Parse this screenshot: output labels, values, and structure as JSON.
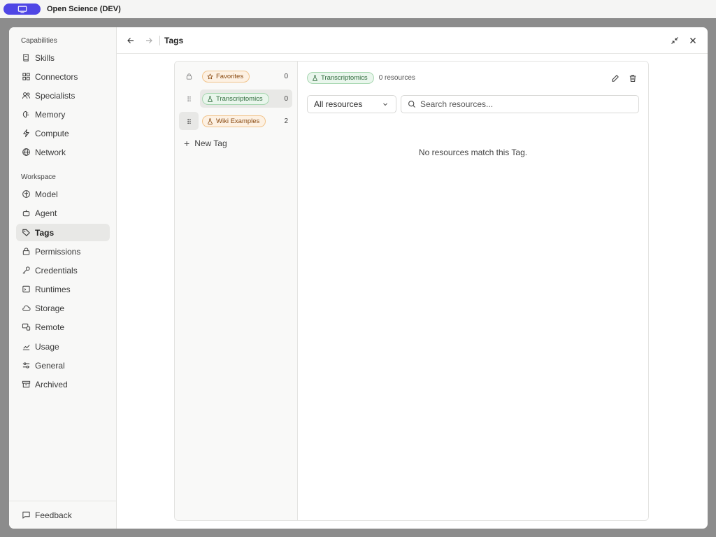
{
  "app": {
    "title": "Open Science (DEV)"
  },
  "sidebar": {
    "capabilities_label": "Capabilities",
    "capabilities": [
      {
        "label": "Skills",
        "icon": "book-icon"
      },
      {
        "label": "Connectors",
        "icon": "grid-icon"
      },
      {
        "label": "Specialists",
        "icon": "users-icon"
      },
      {
        "label": "Memory",
        "icon": "brain-icon"
      },
      {
        "label": "Compute",
        "icon": "bolt-icon"
      },
      {
        "label": "Network",
        "icon": "globe-icon"
      }
    ],
    "workspace_label": "Workspace",
    "workspace": [
      {
        "label": "Model",
        "icon": "model-icon"
      },
      {
        "label": "Agent",
        "icon": "robot-icon"
      },
      {
        "label": "Tags",
        "icon": "tag-icon",
        "active": true
      },
      {
        "label": "Permissions",
        "icon": "lock-icon"
      },
      {
        "label": "Credentials",
        "icon": "key-icon"
      },
      {
        "label": "Runtimes",
        "icon": "terminal-icon"
      },
      {
        "label": "Storage",
        "icon": "cloud-icon"
      },
      {
        "label": "Remote",
        "icon": "remote-icon"
      },
      {
        "label": "Usage",
        "icon": "chart-icon"
      },
      {
        "label": "General",
        "icon": "sliders-icon"
      },
      {
        "label": "Archived",
        "icon": "archive-icon"
      }
    ],
    "feedback_label": "Feedback"
  },
  "header": {
    "title": "Tags"
  },
  "tags": {
    "items": [
      {
        "label": "Favorites",
        "count": "0",
        "color": "orange",
        "icon": "star-icon"
      },
      {
        "label": "Transcriptomics",
        "count": "0",
        "color": "green",
        "icon": "flask-icon"
      },
      {
        "label": "Wiki Examples",
        "count": "2",
        "color": "orange",
        "icon": "flask-icon"
      }
    ],
    "new_tag_label": "New Tag"
  },
  "detail": {
    "tag_label": "Transcriptomics",
    "resource_count": "0 resources",
    "filter_value": "All resources",
    "search_placeholder": "Search resources...",
    "empty_message": "No resources match this Tag."
  }
}
